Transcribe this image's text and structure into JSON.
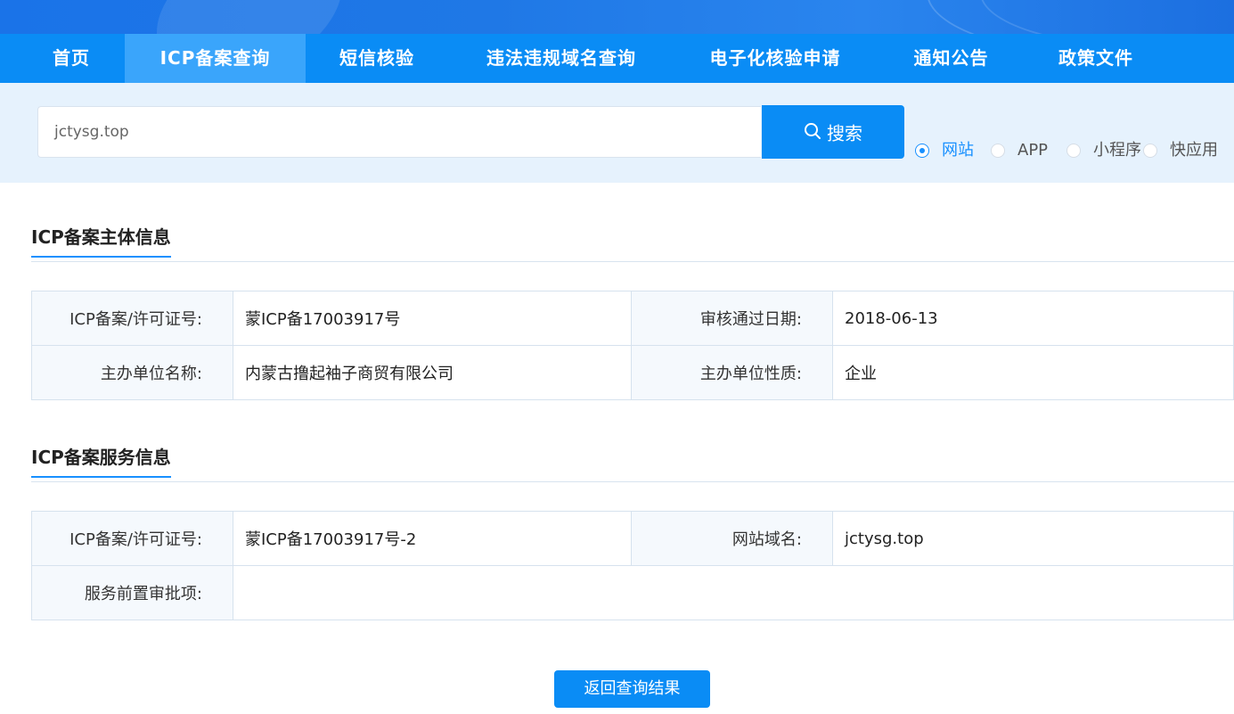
{
  "nav": {
    "items": [
      {
        "label": "首页"
      },
      {
        "label": "ICP备案查询"
      },
      {
        "label": "短信核验"
      },
      {
        "label": "违法违规域名查询"
      },
      {
        "label": "电子化核验申请"
      },
      {
        "label": "通知公告"
      },
      {
        "label": "政策文件"
      }
    ],
    "active": "ICP备案查询"
  },
  "search": {
    "value": "jctysg.top",
    "button_label": "搜索",
    "icon": "search-icon",
    "types": [
      {
        "label": "网站",
        "checked": true
      },
      {
        "label": "APP",
        "checked": false
      },
      {
        "label": "小程序",
        "checked": false
      },
      {
        "label": "快应用",
        "checked": false
      }
    ]
  },
  "subject": {
    "title": "ICP备案主体信息",
    "license_label": "ICP备案/许可证号:",
    "license_value": "蒙ICP备17003917号",
    "date_label": "审核通过日期:",
    "date_value": "2018-06-13",
    "org_label": "主办单位名称:",
    "org_value": "内蒙古撸起袖子商贸有限公司",
    "type_label": "主办单位性质:",
    "type_value": "企业"
  },
  "service": {
    "title": "ICP备案服务信息",
    "license_label": "ICP备案/许可证号:",
    "license_value": "蒙ICP备17003917号-2",
    "domain_label": "网站域名:",
    "domain_value": "jctysg.top",
    "approval_label": "服务前置审批项:",
    "approval_value": ""
  },
  "back_button": "返回查询结果",
  "colors": {
    "primary": "#0a8cf5",
    "active_tab": "#3aa5fb",
    "search_band": "#e6f2fd",
    "radio_checked": "#1890ff"
  }
}
